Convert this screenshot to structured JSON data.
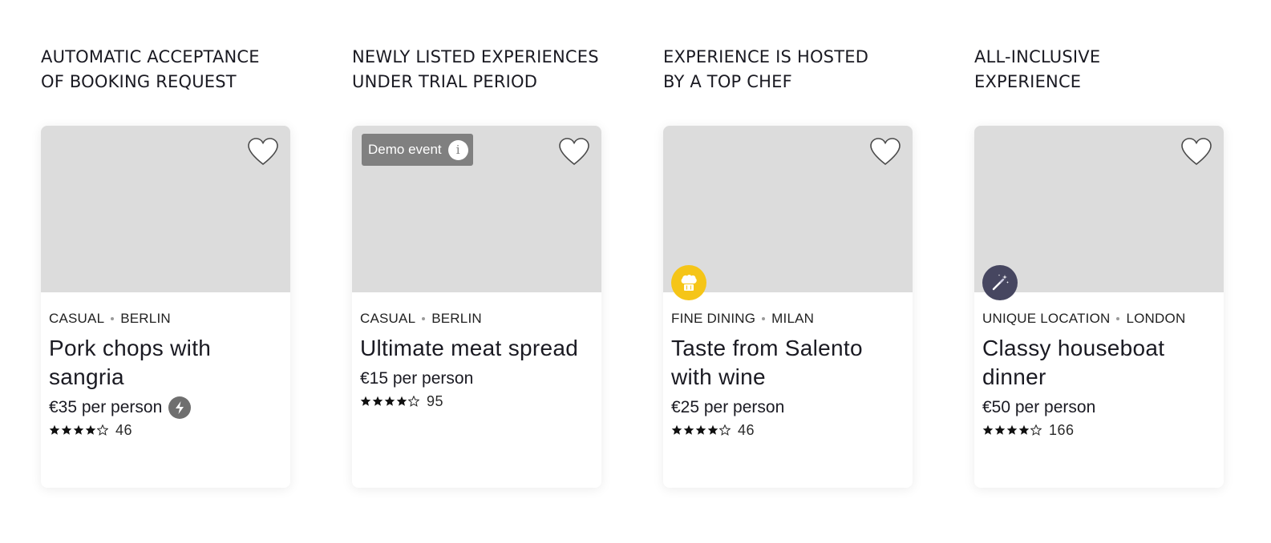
{
  "columns": [
    {
      "heading": "AUTOMATIC ACCEPTANCE\nOF BOOKING REQUEST",
      "card": {
        "category": "CASUAL",
        "city": "BERLIN",
        "title": "Pork chops with sangria",
        "price": "€35 per person",
        "rating": 4,
        "reviews": "46",
        "badge": null,
        "feature_icon": null,
        "instant_icon": "lightning-icon"
      }
    },
    {
      "heading": "NEWLY LISTED EXPERIENCES\nUNDER TRIAL PERIOD",
      "card": {
        "category": "CASUAL",
        "city": "BERLIN",
        "title": "Ultimate meat spread",
        "price": "€15 per person",
        "rating": 4,
        "reviews": "95",
        "badge": "Demo event",
        "badge_icon": "info-icon",
        "feature_icon": null
      }
    },
    {
      "heading": "EXPERIENCE IS HOSTED\nBY A TOP CHEF",
      "card": {
        "category": "FINE DINING",
        "city": "MILAN",
        "title": "Taste from Salento with wine",
        "price": "€25 per person",
        "rating": 4,
        "reviews": "46",
        "badge": null,
        "feature_icon": "chef-hat-icon",
        "feature_color": "#f5c518"
      }
    },
    {
      "heading": "ALL-INCLUSIVE\nEXPERIENCE",
      "card": {
        "category": "UNIQUE LOCATION",
        "city": "LONDON",
        "title": "Classy houseboat dinner",
        "price": "€50 per person",
        "rating": 4,
        "reviews": "166",
        "badge": null,
        "feature_icon": "magic-wand-icon",
        "feature_color": "#464660"
      }
    }
  ],
  "colors": {
    "image_placeholder": "#dcdcdc",
    "badge_bg": "#808080",
    "chef_badge": "#f5c518",
    "wand_badge": "#464660",
    "instant_badge": "#6f6f6f"
  }
}
